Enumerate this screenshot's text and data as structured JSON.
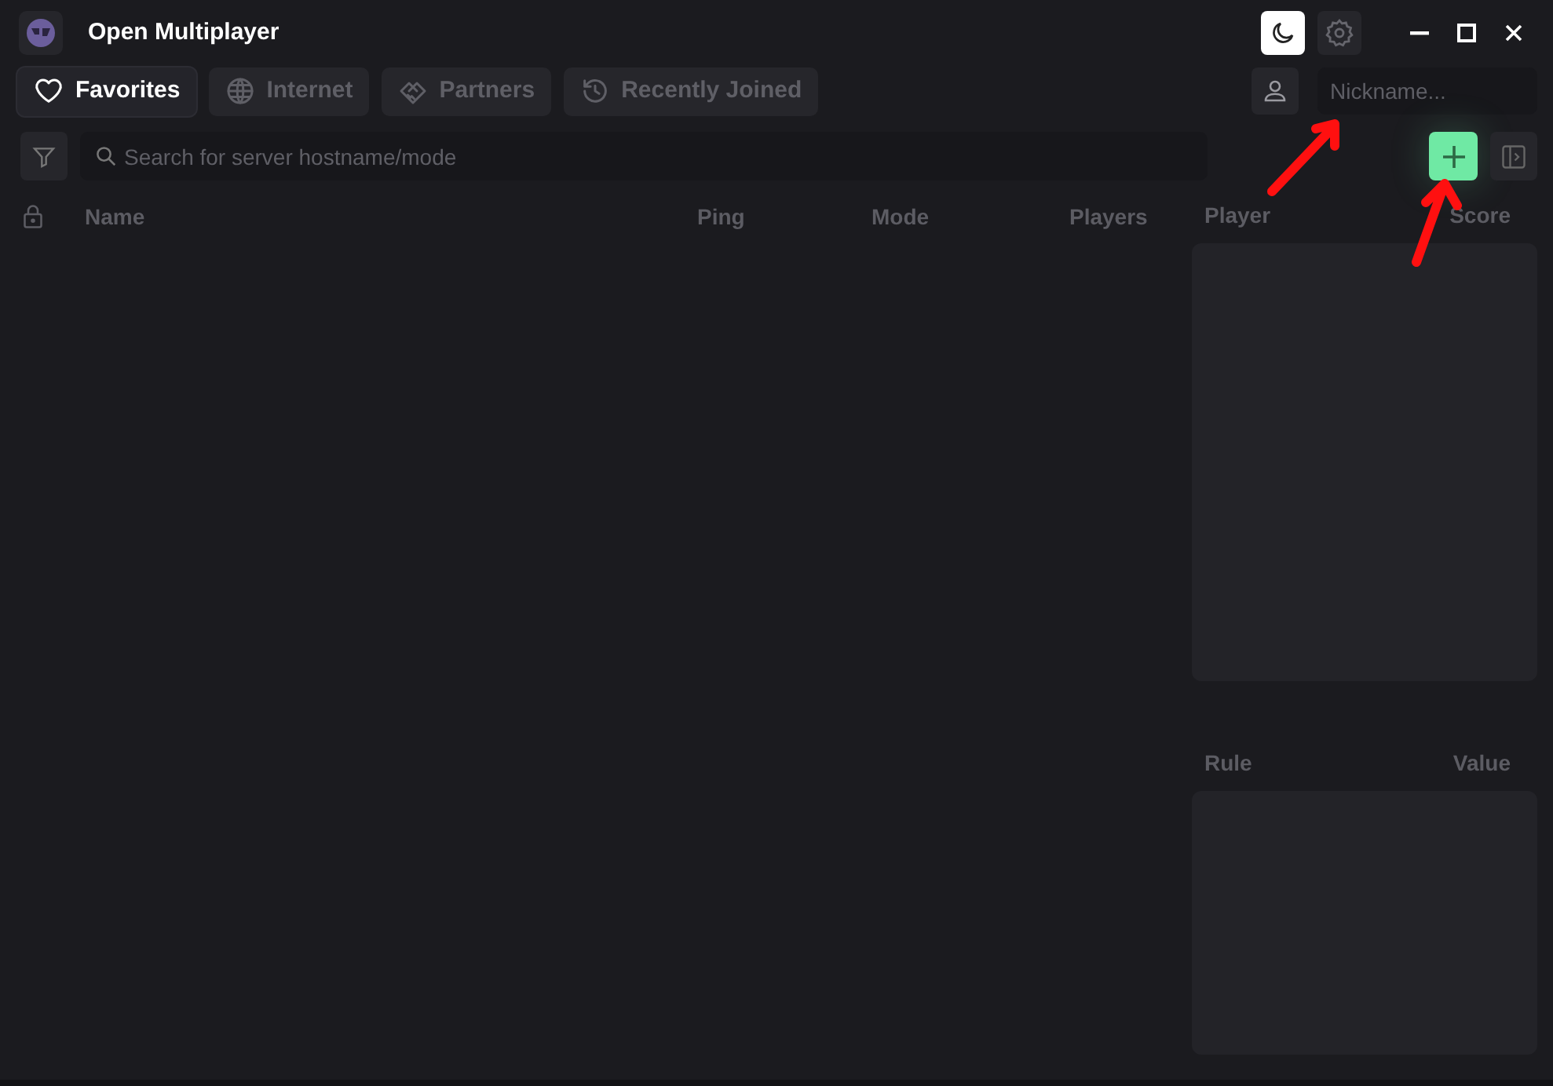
{
  "window": {
    "title": "Open Multiplayer"
  },
  "title_bar": {
    "dark_mode": true
  },
  "tabs": [
    {
      "label": "Favorites",
      "selected": true
    },
    {
      "label": "Internet",
      "selected": false
    },
    {
      "label": "Partners",
      "selected": false
    },
    {
      "label": "Recently Joined",
      "selected": false
    }
  ],
  "nickname": {
    "placeholder": "Nickname..."
  },
  "search": {
    "placeholder": "Search for server hostname/mode"
  },
  "table": {
    "columns": [
      "Name",
      "Ping",
      "Mode",
      "Players"
    ]
  },
  "players_panel": {
    "columns": [
      "Player",
      "Score"
    ]
  },
  "rules_panel": {
    "columns": [
      "Rule",
      "Value"
    ]
  }
}
